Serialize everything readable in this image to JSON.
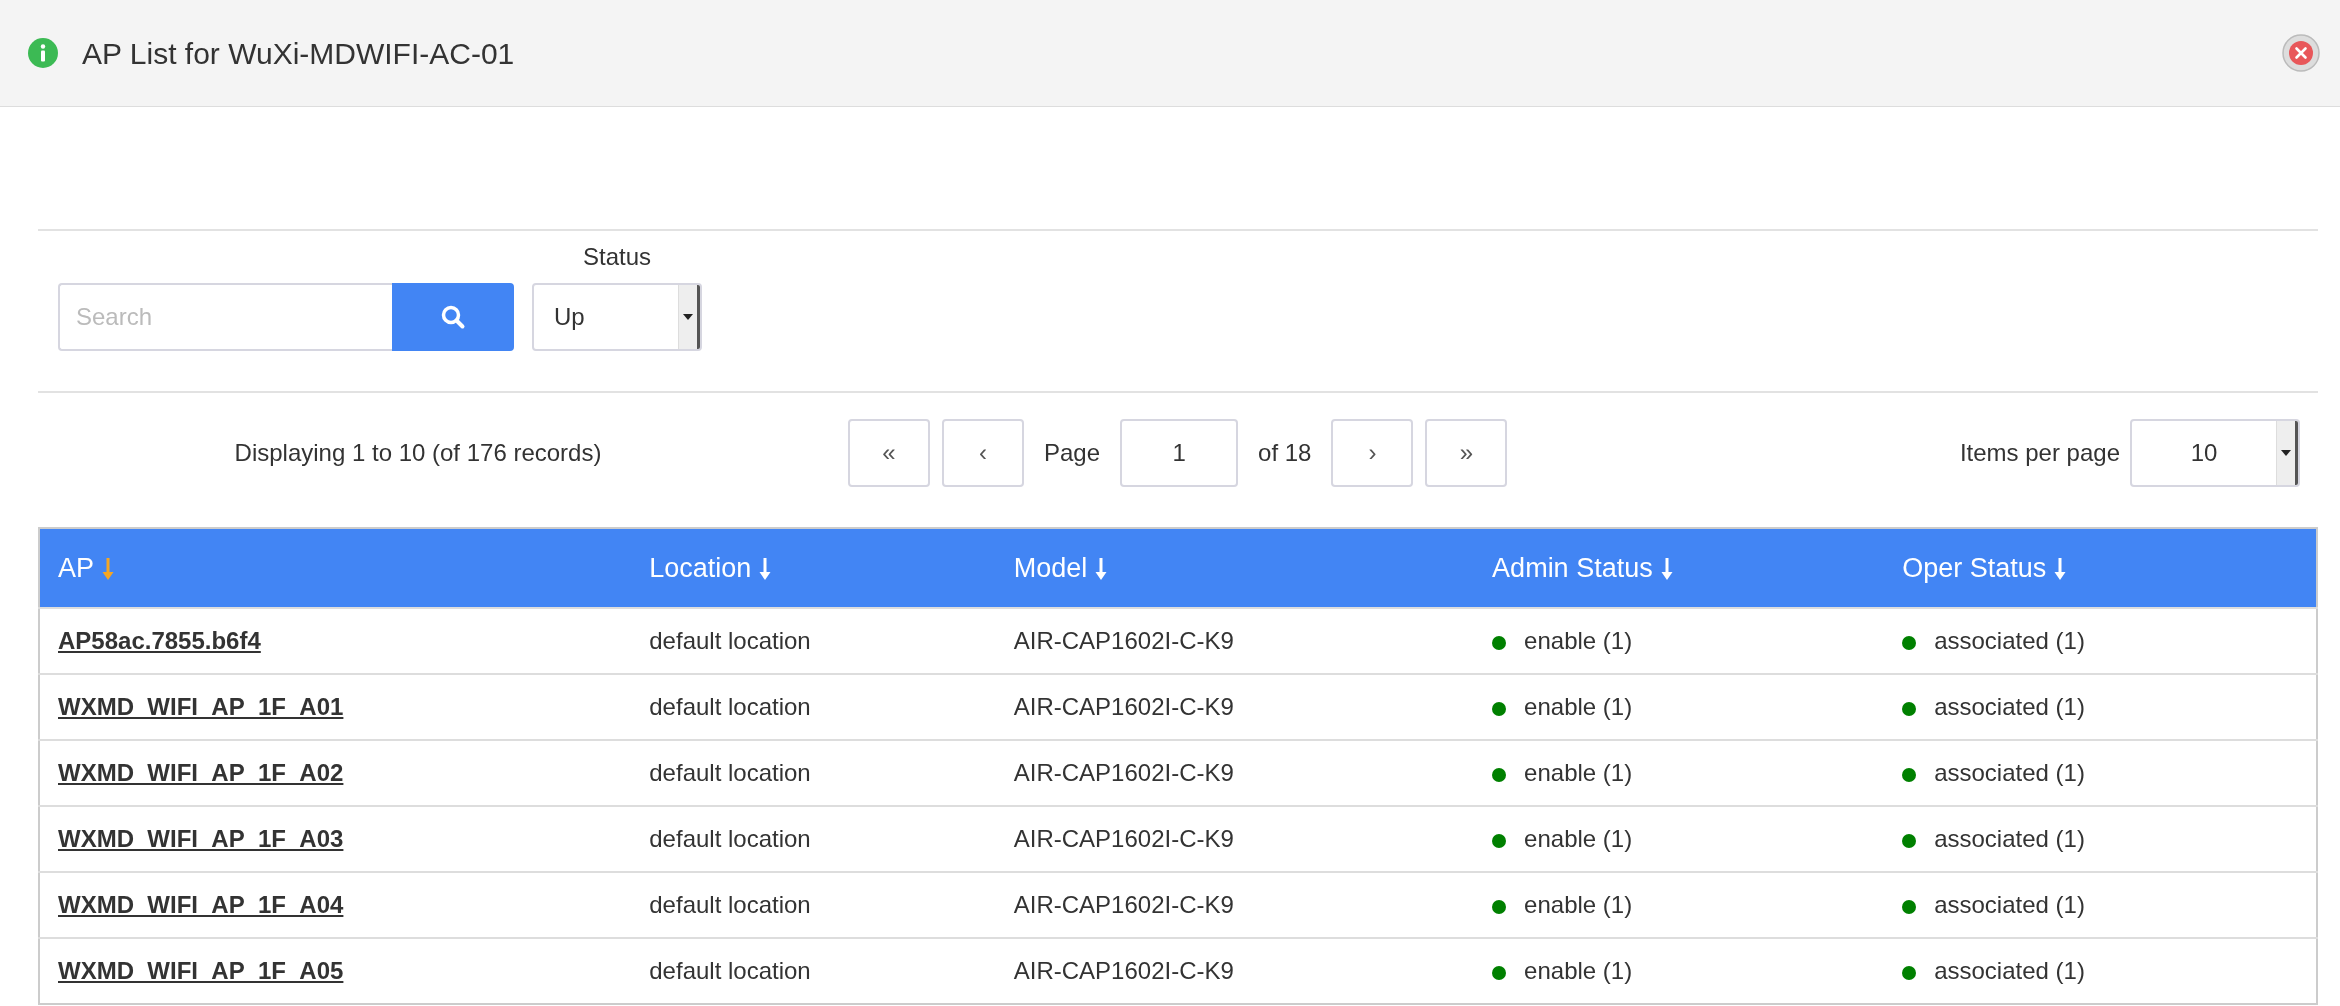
{
  "dialog": {
    "title": "AP List for WuXi-MDWIFI-AC-01"
  },
  "search": {
    "placeholder": "Search"
  },
  "status_filter": {
    "label": "Status",
    "value": "Up"
  },
  "pagination": {
    "summary": "Displaying 1 to 10 (of 176 records)",
    "first": "«",
    "prev": "‹",
    "page_label": "Page",
    "page": "1",
    "of": "of 18",
    "next": "›",
    "last": "»",
    "items_label": "Items per page",
    "items_value": "10"
  },
  "table": {
    "columns": [
      {
        "label": "AP",
        "sorted": true
      },
      {
        "label": "Location",
        "sorted": false
      },
      {
        "label": "Model",
        "sorted": false
      },
      {
        "label": "Admin Status",
        "sorted": false
      },
      {
        "label": "Oper Status",
        "sorted": false
      }
    ],
    "rows": [
      {
        "ap": "AP58ac.7855.b6f4",
        "location": "default location",
        "model": "AIR-CAP1602I-C-K9",
        "admin_status": {
          "text": "enable (1)",
          "color": "#008000"
        },
        "oper_status": {
          "text": "associated (1)",
          "color": "#008000"
        }
      },
      {
        "ap": "WXMD_WIFI_AP_1F_A01",
        "location": "default location",
        "model": "AIR-CAP1602I-C-K9",
        "admin_status": {
          "text": "enable (1)",
          "color": "#008000"
        },
        "oper_status": {
          "text": "associated (1)",
          "color": "#008000"
        }
      },
      {
        "ap": "WXMD_WIFI_AP_1F_A02",
        "location": "default location",
        "model": "AIR-CAP1602I-C-K9",
        "admin_status": {
          "text": "enable (1)",
          "color": "#008000"
        },
        "oper_status": {
          "text": "associated (1)",
          "color": "#008000"
        }
      },
      {
        "ap": "WXMD_WIFI_AP_1F_A03",
        "location": "default location",
        "model": "AIR-CAP1602I-C-K9",
        "admin_status": {
          "text": "enable (1)",
          "color": "#008000"
        },
        "oper_status": {
          "text": "associated (1)",
          "color": "#008000"
        }
      },
      {
        "ap": "WXMD_WIFI_AP_1F_A04",
        "location": "default location",
        "model": "AIR-CAP1602I-C-K9",
        "admin_status": {
          "text": "enable (1)",
          "color": "#008000"
        },
        "oper_status": {
          "text": "associated (1)",
          "color": "#008000"
        }
      },
      {
        "ap": "WXMD_WIFI_AP_1F_A05",
        "location": "default location",
        "model": "AIR-CAP1602I-C-K9",
        "admin_status": {
          "text": "enable (1)",
          "color": "#008000"
        },
        "oper_status": {
          "text": "associated (1)",
          "color": "#008000"
        }
      }
    ]
  }
}
